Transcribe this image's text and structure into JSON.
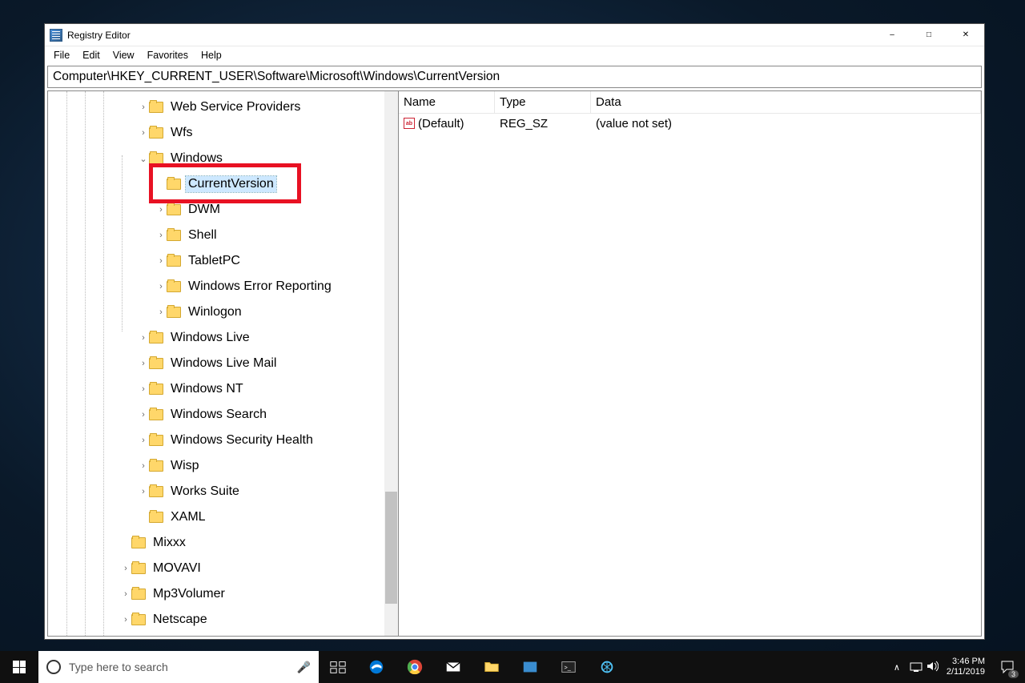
{
  "window": {
    "title": "Registry Editor",
    "address": "Computer\\HKEY_CURRENT_USER\\Software\\Microsoft\\Windows\\CurrentVersion"
  },
  "menu": [
    "File",
    "Edit",
    "View",
    "Favorites",
    "Help"
  ],
  "tree": [
    {
      "indent": 3,
      "exp": ">",
      "label": "Web Service Providers"
    },
    {
      "indent": 3,
      "exp": ">",
      "label": "Wfs"
    },
    {
      "indent": 3,
      "exp": "v",
      "label": "Windows"
    },
    {
      "indent": 4,
      "exp": "",
      "label": "CurrentVersion",
      "selected": true,
      "highlighted": true
    },
    {
      "indent": 4,
      "exp": ">",
      "label": "DWM"
    },
    {
      "indent": 4,
      "exp": ">",
      "label": "Shell"
    },
    {
      "indent": 4,
      "exp": ">",
      "label": "TabletPC"
    },
    {
      "indent": 4,
      "exp": ">",
      "label": "Windows Error Reporting"
    },
    {
      "indent": 4,
      "exp": ">",
      "label": "Winlogon"
    },
    {
      "indent": 3,
      "exp": ">",
      "label": "Windows Live"
    },
    {
      "indent": 3,
      "exp": ">",
      "label": "Windows Live Mail"
    },
    {
      "indent": 3,
      "exp": ">",
      "label": "Windows NT"
    },
    {
      "indent": 3,
      "exp": ">",
      "label": "Windows Search"
    },
    {
      "indent": 3,
      "exp": ">",
      "label": "Windows Security Health"
    },
    {
      "indent": 3,
      "exp": ">",
      "label": "Wisp"
    },
    {
      "indent": 3,
      "exp": ">",
      "label": "Works Suite"
    },
    {
      "indent": 3,
      "exp": "",
      "label": "XAML"
    },
    {
      "indent": 2,
      "exp": "",
      "label": "Mixxx"
    },
    {
      "indent": 2,
      "exp": ">",
      "label": "MOVAVI"
    },
    {
      "indent": 2,
      "exp": ">",
      "label": "Mp3Volumer"
    },
    {
      "indent": 2,
      "exp": ">",
      "label": "Netscape"
    }
  ],
  "list": {
    "columns": {
      "name": "Name",
      "type": "Type",
      "data": "Data"
    },
    "rows": [
      {
        "name": "(Default)",
        "type": "REG_SZ",
        "data": "(value not set)"
      }
    ]
  },
  "taskbar": {
    "search_placeholder": "Type here to search",
    "time": "3:46 PM",
    "date": "2/11/2019",
    "notif_count": "3"
  }
}
